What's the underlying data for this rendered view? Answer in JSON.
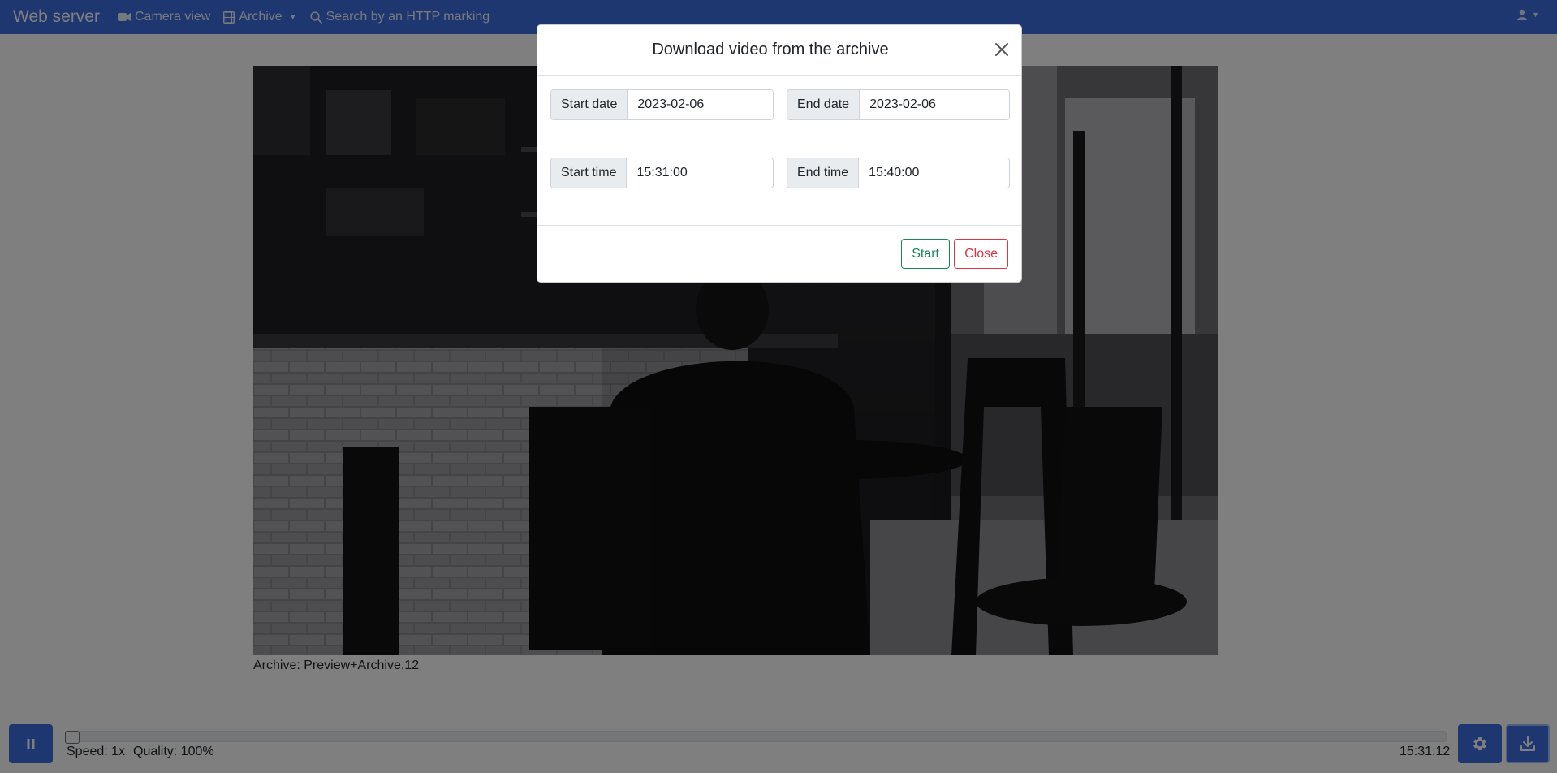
{
  "navbar": {
    "brand": "Web server",
    "items": [
      {
        "label": "Camera view",
        "icon": "video-camera-icon"
      },
      {
        "label": "Archive",
        "icon": "film-icon",
        "has_dropdown": true
      },
      {
        "label": "Search by an HTTP marking",
        "icon": "search-icon"
      }
    ],
    "user_icon": "user-icon"
  },
  "main": {
    "archive_caption": "Archive: Preview+Archive.12"
  },
  "controls": {
    "speed": "Speed: 1x",
    "quality": "Quality: 100%",
    "time": "15:31:12",
    "timeline_position": 0.0,
    "icons": [
      "pause-icon",
      "gear-icon",
      "download-icon"
    ]
  },
  "modal": {
    "title": "Download video from the archive",
    "start_date_label": "Start date",
    "start_date_value": "2023-02-06",
    "end_date_label": "End date",
    "end_date_value": "2023-02-06",
    "start_time_label": "Start time",
    "start_time_value": "15:31:00",
    "end_time_label": "End time",
    "end_time_value": "15:40:00",
    "start_button": "Start",
    "close_button": "Close"
  },
  "colors": {
    "primary": "#3d6fe0",
    "success": "#198754",
    "danger": "#dc3545"
  }
}
